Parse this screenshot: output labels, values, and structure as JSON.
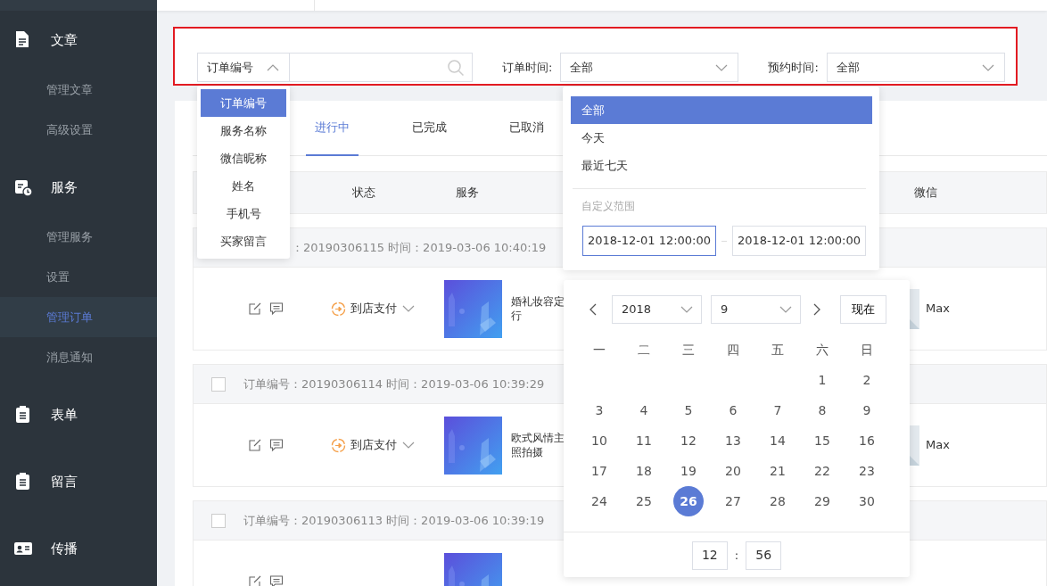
{
  "sidebar": {
    "groups": [
      {
        "label": "文章",
        "items": [
          {
            "label": "管理文章",
            "selected": false
          },
          {
            "label": "高级设置",
            "selected": false
          }
        ]
      },
      {
        "label": "服务",
        "items": [
          {
            "label": "管理服务",
            "selected": false
          },
          {
            "label": "设置",
            "selected": false
          },
          {
            "label": "管理订单",
            "selected": true
          },
          {
            "label": "消息通知",
            "selected": false
          }
        ]
      },
      {
        "label": "表单"
      },
      {
        "label": "留言"
      },
      {
        "label": "传播"
      }
    ]
  },
  "filter": {
    "search_type": {
      "value": "订单编号",
      "expanded": true
    },
    "order_time": {
      "label": "订单时间:",
      "value": "全部"
    },
    "booking_time": {
      "label": "预约时间:",
      "value": "全部"
    }
  },
  "tabs": [
    {
      "label": "进行中",
      "selected": true
    },
    {
      "label": "已完成",
      "selected": false
    },
    {
      "label": "已取消",
      "selected": false
    }
  ],
  "table": {
    "columns": [
      "状态",
      "服务",
      "微信"
    ],
    "orders": [
      {
        "header": "：20190306115  时间：2019-03-06 10:40:19",
        "status": "到店支付",
        "service": "婚礼妆容定行",
        "buyer": "Max"
      },
      {
        "checked": false,
        "header": "订单编号：20190306114  时间：2019-03-06 10:39:29",
        "status": "到店支付",
        "service": "欧式风情主照拍摄",
        "buyer": "Max"
      },
      {
        "checked": false,
        "header": "订单编号：20190306113  时间：2019-03-06 10:39:19"
      }
    ]
  },
  "search_type_menu": [
    {
      "label": "订单编号",
      "selected": true
    },
    {
      "label": "服务名称",
      "selected": false
    },
    {
      "label": "微信昵称",
      "selected": false
    },
    {
      "label": "姓名",
      "selected": false
    },
    {
      "label": "手机号",
      "selected": false
    },
    {
      "label": "买家留言",
      "selected": false
    }
  ],
  "time_menu": {
    "options": [
      {
        "label": "全部",
        "selected": true
      },
      {
        "label": "今天",
        "selected": false
      },
      {
        "label": "最近七天",
        "selected": false
      }
    ],
    "custom_label": "自定义范围",
    "start": {
      "value": "2018-12-01 12:00:00",
      "focused": true
    },
    "end": {
      "value": "2018-12-01 12:00:00",
      "focused": false
    }
  },
  "calendar": {
    "year": "2018",
    "month": "9",
    "now_button": "现在",
    "weekdays": [
      "一",
      "二",
      "三",
      "四",
      "五",
      "六",
      "日"
    ],
    "weeks": [
      [
        {
          "day": "1",
          "selected": false
        },
        {
          "day": "2",
          "selected": false
        }
      ],
      [
        {
          "day": "3",
          "selected": false
        },
        {
          "day": "4",
          "selected": false
        },
        {
          "day": "5",
          "selected": false
        },
        {
          "day": "6",
          "selected": false
        },
        {
          "day": "7",
          "selected": false
        },
        {
          "day": "8",
          "selected": false
        },
        {
          "day": "9",
          "selected": false
        }
      ],
      [
        {
          "day": "10",
          "selected": false
        },
        {
          "day": "11",
          "selected": false
        },
        {
          "day": "12",
          "selected": false
        },
        {
          "day": "13",
          "selected": false
        },
        {
          "day": "14",
          "selected": false
        },
        {
          "day": "15",
          "selected": false
        },
        {
          "day": "16",
          "selected": false
        }
      ],
      [
        {
          "day": "17",
          "selected": false
        },
        {
          "day": "18",
          "selected": false
        },
        {
          "day": "19",
          "selected": false
        },
        {
          "day": "20",
          "selected": false
        },
        {
          "day": "21",
          "selected": false
        },
        {
          "day": "22",
          "selected": false
        },
        {
          "day": "23",
          "selected": false
        }
      ],
      [
        {
          "day": "24",
          "selected": false
        },
        {
          "day": "25",
          "selected": false
        },
        {
          "day": "26",
          "selected": true
        },
        {
          "day": "27",
          "selected": false
        },
        {
          "day": "28",
          "selected": false
        },
        {
          "day": "29",
          "selected": false
        },
        {
          "day": "30",
          "selected": false
        }
      ]
    ],
    "hour": "12",
    "separator": ":",
    "minute": "56"
  }
}
